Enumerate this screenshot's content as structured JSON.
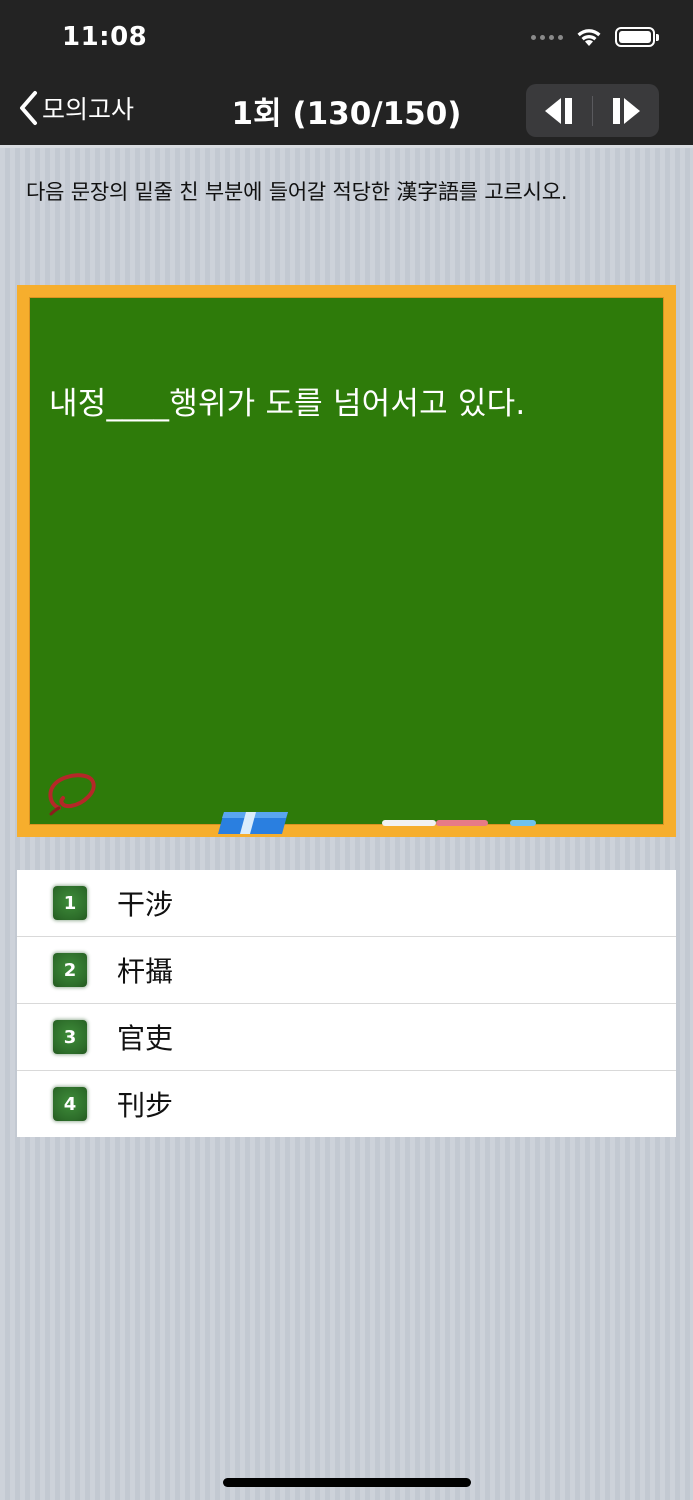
{
  "status": {
    "time": "11:08"
  },
  "nav": {
    "back_label": "모의고사",
    "title": "1회 (130/150)"
  },
  "instruction": "다음 문장의 밑줄 친 부분에 들어갈 적당한 漢字語를 고르시오.",
  "board": {
    "question": "내정____행위가 도를 넘어서고 있다."
  },
  "answers": [
    {
      "number": "1",
      "text": "干涉"
    },
    {
      "number": "2",
      "text": "杆攝"
    },
    {
      "number": "3",
      "text": "官吏"
    },
    {
      "number": "4",
      "text": "刊步"
    }
  ],
  "colors": {
    "board_green": "#2e7b0a",
    "board_frame": "#f6ae2d",
    "badge_green": "#2d6d2a"
  }
}
